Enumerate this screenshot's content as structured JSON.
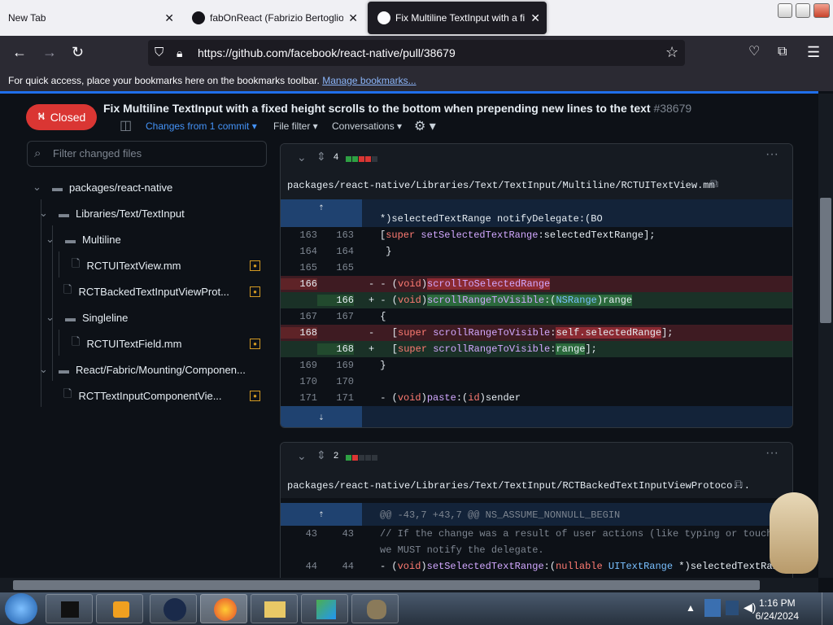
{
  "browser": {
    "tabs": [
      {
        "label": "New Tab"
      },
      {
        "label": "fabOnReact (Fabrizio Bertoglio)"
      },
      {
        "label": "Fix Multiline TextInput with a fi"
      }
    ],
    "url": "https://github.com/facebook/react-native/pull/38679",
    "bookmarks_hint": "For quick access, place your bookmarks here on the bookmarks toolbar.",
    "bookmarks_link": "Manage bookmarks..."
  },
  "pr": {
    "status": "Closed",
    "title": "Fix Multiline TextInput with a fixed height scrolls to the bottom when prepending new lines to the text",
    "number": "#38679",
    "changes_from": "Changes from 1 commit",
    "file_filter": "File filter",
    "conversations": "Conversations"
  },
  "sidebar": {
    "filter_placeholder": "Filter changed files",
    "tree": [
      {
        "label": "packages/react-native"
      },
      {
        "label": "Libraries/Text/TextInput"
      },
      {
        "label": "Multiline"
      },
      {
        "label": "RCTUITextView.mm"
      },
      {
        "label": "RCTBackedTextInputViewProt..."
      },
      {
        "label": "Singleline"
      },
      {
        "label": "RCTUITextField.mm"
      },
      {
        "label": "React/Fabric/Mounting/Componen..."
      },
      {
        "label": "RCTTextInputComponentVie..."
      }
    ]
  },
  "diff1": {
    "changes": "4",
    "path": "packages/react-native/Libraries/Text/TextInput/Multiline/RCTUITextView.mm",
    "lines": [
      {
        "n1": "163",
        "n2": "163",
        "code": "   [super setSelectedTextRange:selectedTextRange];"
      },
      {
        "n1": "164",
        "n2": "164",
        "code": " }"
      },
      {
        "n1": "165",
        "n2": "165",
        "code": ""
      },
      {
        "n1": "166",
        "n2": "",
        "code": "- (void)scrollToSelectedRange"
      },
      {
        "n1": "",
        "n2": "166",
        "code": "- (void)scrollRangeToVisible:(NSRange)range"
      },
      {
        "n1": "167",
        "n2": "167",
        "code": " {"
      },
      {
        "n1": "168",
        "n2": "",
        "code": "   [super scrollRangeToVisible:self.selectedRange];"
      },
      {
        "n1": "",
        "n2": "168",
        "code": "   [super scrollRangeToVisible:range];"
      },
      {
        "n1": "169",
        "n2": "169",
        "code": " }"
      },
      {
        "n1": "170",
        "n2": "170",
        "code": ""
      },
      {
        "n1": "171",
        "n2": "171",
        "code": " - (void)paste:(id)sender"
      }
    ],
    "top_context": "*)selectedTextRange notifyDelegate:(BO"
  },
  "diff2": {
    "changes": "2",
    "path": "packages/react-native/Libraries/Text/TextInput/RCTBackedTextInputViewProtoco...",
    "hunk": "@@ -43,7 +43,7 @@ NS_ASSUME_NONNULL_BEGIN",
    "lines": [
      {
        "n1": "43",
        "n2": "43",
        "code": "// If the change was a result of user actions (like typing or touches)"
      },
      {
        "n1": "",
        "n2": "",
        "code": "we MUST notify the delegate."
      },
      {
        "n1": "44",
        "n2": "44",
        "code": "- (void)setSelectedTextRange:(nullable UITextRange *)selectedTextRange"
      }
    ]
  },
  "taskbar": {
    "time": "1:16 PM",
    "date": "6/24/2024"
  }
}
